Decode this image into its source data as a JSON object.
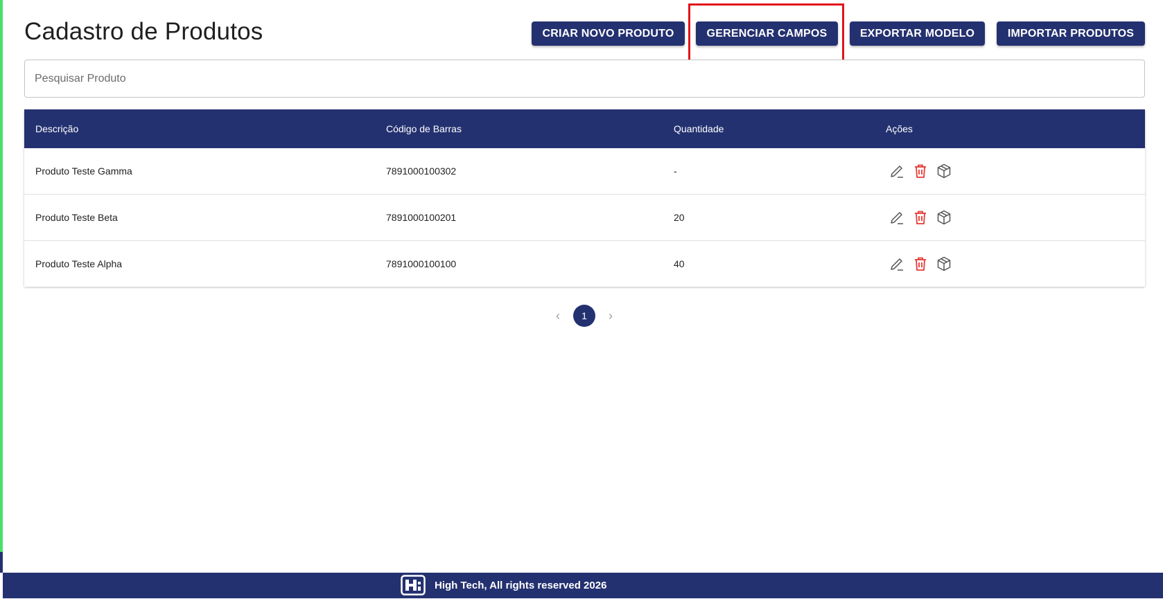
{
  "page": {
    "title": "Cadastro de Produtos"
  },
  "toolbar": {
    "create_label": "CRIAR NOVO PRODUTO",
    "manage_fields_label": "GERENCIAR CAMPOS",
    "export_label": "EXPORTAR MODELO",
    "import_label": "IMPORTAR PRODUTOS"
  },
  "search": {
    "placeholder": "Pesquisar Produto",
    "value": ""
  },
  "table": {
    "headers": {
      "description": "Descrição",
      "barcode": "Código de Barras",
      "quantity": "Quantidade",
      "actions": "Ações"
    },
    "rows": [
      {
        "description": "Produto Teste Gamma",
        "barcode": "7891000100302",
        "quantity": "-"
      },
      {
        "description": "Produto Teste Beta",
        "barcode": "7891000100201",
        "quantity": "20"
      },
      {
        "description": "Produto Teste Alpha",
        "barcode": "7891000100100",
        "quantity": "40"
      }
    ],
    "row_actions": [
      "edit-icon",
      "trash-icon",
      "box-icon"
    ]
  },
  "pagination": {
    "current_page": "1",
    "prev_icon": "chevron-left-icon",
    "next_icon": "chevron-right-icon"
  },
  "footer": {
    "text": "High Tech, All rights reserved 2026"
  },
  "colors": {
    "primary": "#243170",
    "danger": "#e53935",
    "highlight": "#e1141b",
    "accent_bar": "#4cde6a"
  }
}
